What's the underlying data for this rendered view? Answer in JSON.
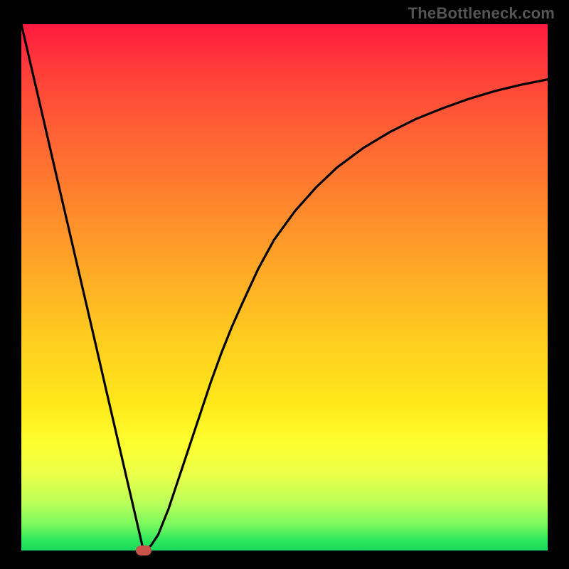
{
  "watermark": "TheBottleneck.com",
  "chart_data": {
    "type": "line",
    "title": "",
    "xlabel": "",
    "ylabel": "",
    "xlim": [
      0,
      100
    ],
    "ylim": [
      0,
      100
    ],
    "series": [
      {
        "name": "curve",
        "x": [
          0.0,
          2.0,
          4.0,
          6.0,
          8.0,
          10.0,
          12.0,
          14.0,
          16.0,
          18.0,
          20.0,
          22.0,
          23.2,
          24.6,
          26.0,
          28.0,
          30.0,
          32.0,
          34.0,
          36.0,
          38.0,
          40.0,
          42.0,
          45.0,
          48.0,
          52.0,
          56.0,
          60.0,
          65.0,
          70.0,
          75.0,
          80.0,
          85.0,
          90.0,
          95.0,
          100.0
        ],
        "y": [
          100.0,
          91.4,
          82.8,
          74.1,
          65.5,
          56.9,
          48.3,
          39.7,
          31.0,
          22.4,
          13.8,
          5.2,
          0.0,
          0.9,
          3.0,
          8.0,
          14.0,
          20.0,
          26.0,
          32.0,
          37.5,
          42.5,
          47.0,
          53.5,
          59.0,
          64.5,
          69.0,
          72.8,
          76.5,
          79.5,
          82.0,
          84.0,
          85.8,
          87.3,
          88.5,
          89.5
        ]
      }
    ],
    "marker": {
      "x": 23.2,
      "y": 0.0,
      "color": "#c9524a"
    },
    "background_gradient": {
      "direction": "top_high_to_bottom_low",
      "stops": [
        {
          "pos": 0.0,
          "color": "#ff1a3e"
        },
        {
          "pos": 0.5,
          "color": "#ffbe24"
        },
        {
          "pos": 0.8,
          "color": "#fdff30"
        },
        {
          "pos": 1.0,
          "color": "#17d85a"
        }
      ]
    }
  }
}
